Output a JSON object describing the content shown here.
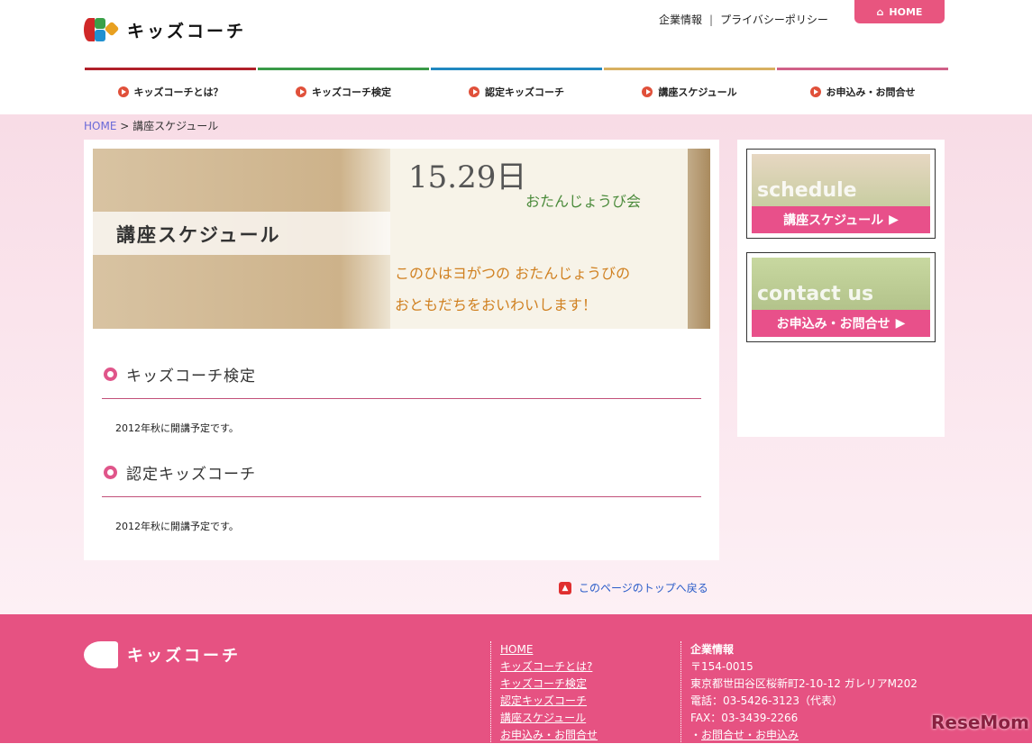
{
  "header": {
    "logo_text": "キッズコーチ",
    "top_links": [
      "企業情報",
      "プライバシーポリシー"
    ],
    "separator": "|",
    "home_button": "HOME"
  },
  "nav": [
    {
      "label": "キッズコーチとは？",
      "color": "#b0202a"
    },
    {
      "label": "キッズコーチ検定",
      "color": "#3a9a48"
    },
    {
      "label": "認定キッズコーチ",
      "color": "#2088c0"
    },
    {
      "label": "講座スケジュール",
      "color": "#d8b060"
    },
    {
      "label": "お申込み・お問合せ",
      "color": "#d06088"
    }
  ],
  "breadcrumb": {
    "home": "HOME",
    "sep": ">",
    "current": "講座スケジュール"
  },
  "hero": {
    "title": "講座スケジュール",
    "note_lines": [
      "15.29日",
      "おたんじょうび会",
      "このひはヨがつの おたんじょうびの",
      "おともだちをおいわいします！"
    ]
  },
  "sections": [
    {
      "title": "キッズコーチ検定",
      "body": "2012年秋に開講予定です。"
    },
    {
      "title": "認定キッズコーチ",
      "body": "2012年秋に開講予定です。"
    }
  ],
  "sidebar": [
    {
      "word": "schedule",
      "label": "講座スケジュール"
    },
    {
      "word": "contact us",
      "label": "お申込み・お問合せ"
    }
  ],
  "page_top": "このページのトップへ戻る",
  "footer": {
    "logo_text": "キッズコーチ",
    "links": [
      "HOME",
      "キッズコーチとは?",
      "キッズコーチ検定",
      "認定キッズコーチ",
      "講座スケジュール",
      "お申込み・お問合せ"
    ],
    "company": {
      "heading": "企業情報",
      "postal": "〒154-0015",
      "address": "東京都世田谷区桜新町2-10-12 ガレリアM202",
      "phone": "電話：03-5426-3123（代表）",
      "fax": "FAX：03-3439-2266",
      "contact_link": "お問合せ・お申込み",
      "bullet": "・"
    }
  },
  "watermark": "ReseMom"
}
